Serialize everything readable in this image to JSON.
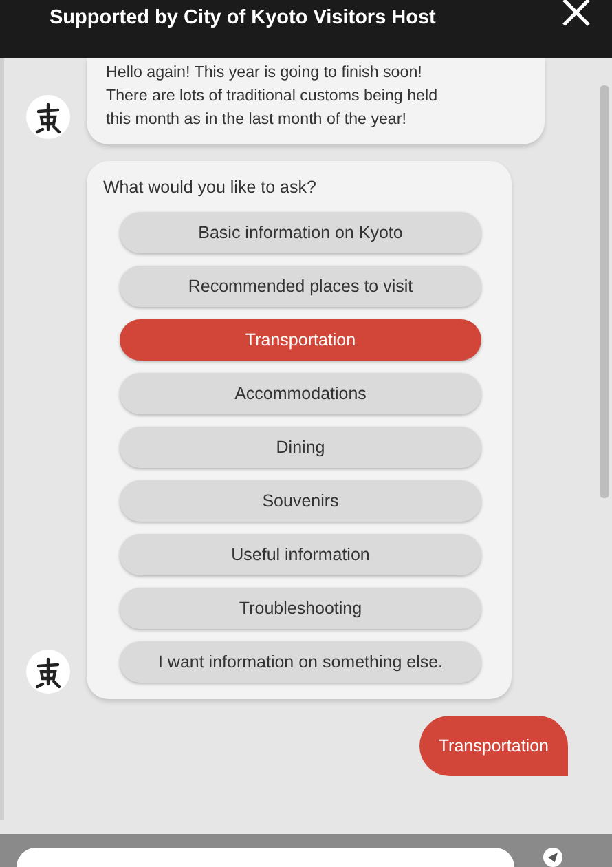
{
  "header": {
    "title": "Supported by City of Kyoto Visitors Host"
  },
  "messages": [
    {
      "kind": "bot_text",
      "lines": [
        "Hello again! This year is going to finish soon!",
        "There are lots of traditional customs being held",
        "this month as in the last month of the year!"
      ]
    },
    {
      "kind": "bot_options",
      "prompt": "What would you like to ask?",
      "options": [
        {
          "label": "Basic information on Kyoto",
          "selected": false
        },
        {
          "label": "Recommended places to visit",
          "selected": false
        },
        {
          "label": "Transportation",
          "selected": true
        },
        {
          "label": "Accommodations",
          "selected": false
        },
        {
          "label": "Dining",
          "selected": false
        },
        {
          "label": "Souvenirs",
          "selected": false
        },
        {
          "label": "Useful information",
          "selected": false
        },
        {
          "label": "Troubleshooting",
          "selected": false
        },
        {
          "label": "I want information on something else.",
          "selected": false
        }
      ]
    },
    {
      "kind": "user_text",
      "text": "Transportation"
    }
  ]
}
